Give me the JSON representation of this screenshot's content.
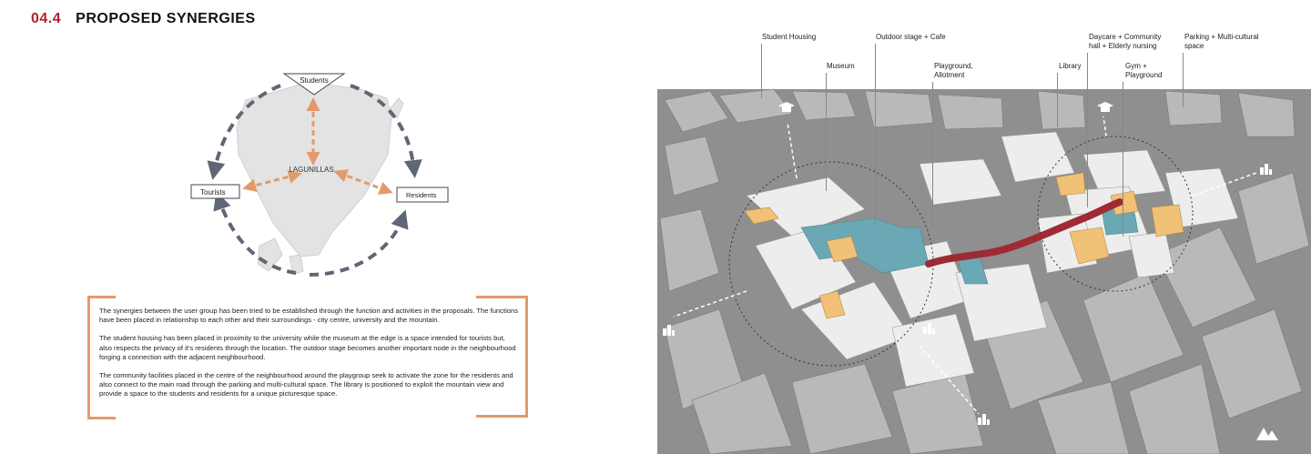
{
  "header": {
    "section_number": "04.4",
    "section_title": "PROPOSED SYNERGIES"
  },
  "diagram": {
    "center_label": "LAGUNILLAS",
    "nodes": {
      "students": "Students",
      "tourists": "Tourists",
      "residents": "Residents"
    },
    "colors": {
      "cycle_arrows": "#5f6675",
      "synergy_arrows": "#e39a6a",
      "site": "#e3e3e3"
    }
  },
  "description": {
    "paragraph_1": "The synergies between the user group has been tried to be established through the function and activities in the proposals. The functions have been placed in relationship to each other and their surroundings - city centre, university and the mountain.",
    "paragraph_2": "The student housing has been placed in proximity to the university while the museum at the edge is a space intended for tourists but, also respects the privacy of it's residents through the location. The outdoor stage becomes another important node in the neighbourhood forging a connection with the adjacent neighbourhood.",
    "paragraph_3": " The community facilities placed in the centre of the neighbourhood around the playgroup seek to activate the zone for the residents and also connect to the main road through the parking and multi-cultural space. The library is positioned to exploit the mountain view and provide a space to the students and residents for a unique picturesque space."
  },
  "map": {
    "callouts": [
      {
        "id": "student-housing",
        "label": "Student Housing"
      },
      {
        "id": "museum",
        "label": "Museum"
      },
      {
        "id": "outdoor-stage",
        "label": "Outdoor stage + Cafe"
      },
      {
        "id": "playground",
        "label": "Playground,\nAllotment"
      },
      {
        "id": "library",
        "label": "Library"
      },
      {
        "id": "daycare",
        "label": "Daycare + Community\nhall + Elderly nursing"
      },
      {
        "id": "gym",
        "label": "Gym +\nPlayground"
      },
      {
        "id": "parking",
        "label": "Parking + Multi-cultural\nspace"
      }
    ],
    "colors": {
      "public_space": "#6aa8b5",
      "facilities": "#f0c177",
      "route": "#9e2b34",
      "buildings": "#ededed"
    },
    "icons": [
      "graduation-cap-icon",
      "graduation-cap-icon",
      "city-buildings-icon",
      "city-buildings-icon",
      "city-buildings-icon",
      "city-buildings-icon",
      "mountain-icon"
    ]
  }
}
